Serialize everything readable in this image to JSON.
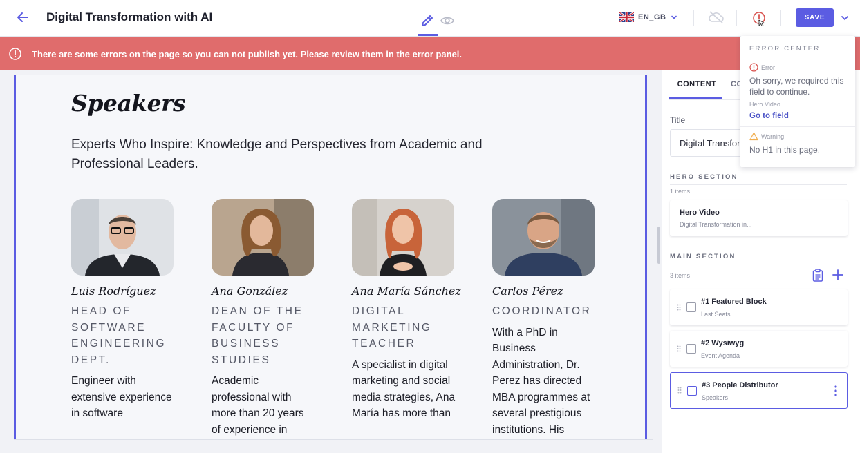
{
  "header": {
    "title": "Digital Transformation with AI",
    "language": "EN_GB",
    "save_label": "SAVE"
  },
  "banner": {
    "message": "There are some errors on the page so you can not publish yet. Please review them in the error panel."
  },
  "section": {
    "title": "Speakers",
    "subtitle": "Experts Who Inspire: Knowledge and Perspectives from Academic and Professional Leaders.",
    "people": [
      {
        "name": "Luis Rodríguez",
        "role": "HEAD OF SOFTWARE ENGINEERING DEPT.",
        "bio": "Engineer with extensive experience in software"
      },
      {
        "name": "Ana González",
        "role": "DEAN OF THE FACULTY OF BUSINESS STUDIES",
        "bio": "Academic professional with more than 20 years of experience in"
      },
      {
        "name": "Ana María Sánchez",
        "role": "DIGITAL MARKETING TEACHER",
        "bio": "A specialist in digital marketing and social media strategies, Ana María has more than"
      },
      {
        "name": "Carlos Pérez",
        "role": "COORDINATOR",
        "bio": "With a PhD in Business Administration, Dr. Perez has directed MBA programmes at several prestigious institutions. His"
      }
    ]
  },
  "panel": {
    "tab_content": "CONTENT",
    "tab_other": "CO",
    "title_label": "Title",
    "title_value": "Digital Transformation with AI",
    "hero": {
      "label": "HERO SECTION",
      "count": "1 items",
      "items": [
        {
          "title": "Hero Video",
          "subtitle": "Digital Transformation in..."
        }
      ]
    },
    "main": {
      "label": "MAIN SECTION",
      "count": "3 items",
      "items": [
        {
          "title": "#1 Featured Block",
          "subtitle": "Last Seats"
        },
        {
          "title": "#2 Wysiwyg",
          "subtitle": "Event Agenda"
        },
        {
          "title": "#3 People Distributor",
          "subtitle": "Speakers"
        }
      ]
    }
  },
  "error_center": {
    "title": "ERROR CENTER",
    "error": {
      "type": "Error",
      "message": "Oh sorry, we required this field to continue.",
      "field": "Hero Video",
      "link": "Go to field"
    },
    "warning": {
      "type": "Warning",
      "message": "No H1 in this page."
    }
  },
  "colors": {
    "accent": "#5b5ce2",
    "error_banner": "#e06c6c",
    "error_icon": "#d9534f",
    "warning_icon": "#f0ad4e",
    "link": "#4d55c7"
  }
}
